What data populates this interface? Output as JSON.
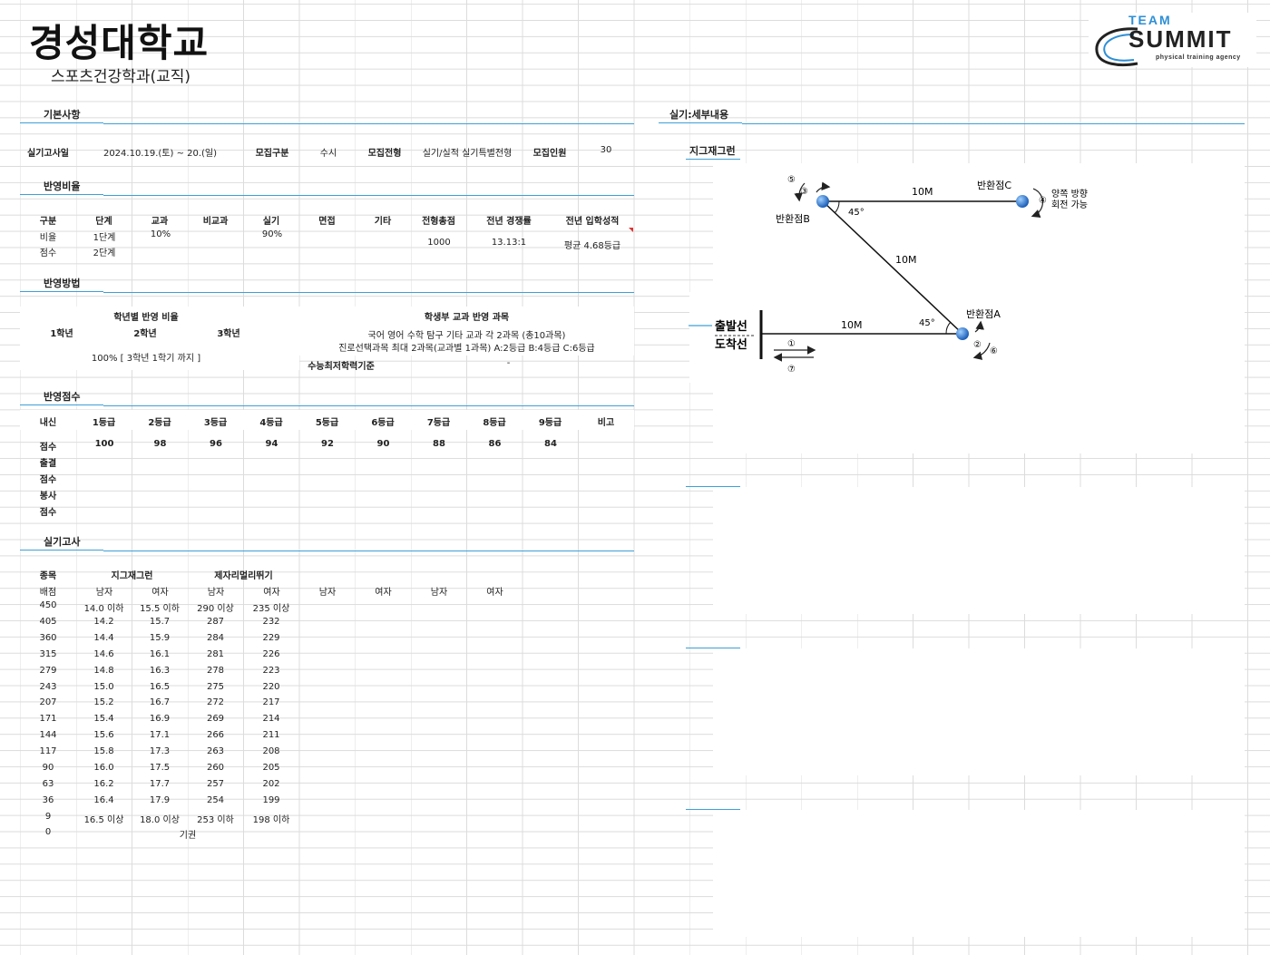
{
  "header": {
    "title": "경성대학교",
    "subtitle": "스포츠건강학과(교직)",
    "logo": {
      "team": "TEAM",
      "name": "SUMMIT",
      "tagline": "physical training agency"
    }
  },
  "sections": {
    "basic": "기본사항",
    "ratio": "반영비율",
    "method": "반영방법",
    "score": "반영점수",
    "practical": "실기고사",
    "detail": "실기:세부내용",
    "zigzag": "지그재그런"
  },
  "basic": {
    "date_label": "실기고사일",
    "date_value": "2024.10.19.(토) ~ 20.(일)",
    "type_label": "모집구분",
    "type_value": "수시",
    "track_label": "모집전형",
    "track_value": "실기/실적 실기특별전형",
    "quota_label": "모집인원",
    "quota_value": "30"
  },
  "ratio": {
    "headers": [
      "구분",
      "단계",
      "교과",
      "비교과",
      "실기",
      "면접",
      "기타",
      "전형총점",
      "전년 경쟁률",
      "전년 입학성적"
    ],
    "row1": [
      "비율",
      "1단계",
      "10%",
      "",
      "90%"
    ],
    "row2": [
      "점수",
      "2단계"
    ],
    "total": "1000",
    "competition": "13.13:1",
    "prev_grade": "평균 4.68등급"
  },
  "method": {
    "year_title": "학년별 반영 비율",
    "years": [
      "1학년",
      "2학년",
      "3학년"
    ],
    "year_value": "100% [ 3학년 1학기 까지 ]",
    "subject_title": "학생부 교과 반영 과목",
    "subject_line1": "국어 영어 수학 탐구 기타 교과 각 2과목 (총10과목)",
    "subject_line2": "진로선택과목 최대 2과목(교과별 1과목) A:2등급 B:4등급 C:6등급",
    "min_label": "수능최저학력기준",
    "min_value": "-"
  },
  "score": {
    "headers": [
      "내신",
      "1등급",
      "2등급",
      "3등급",
      "4등급",
      "5등급",
      "6등급",
      "7등급",
      "8등급",
      "9등급",
      "비고"
    ],
    "row_label": "점수",
    "values": [
      "100",
      "98",
      "96",
      "94",
      "92",
      "90",
      "88",
      "86",
      "84"
    ],
    "extra_rows": [
      "출결",
      "점수",
      "봉사",
      "점수"
    ]
  },
  "practical": {
    "event_label": "종목",
    "event1": "지그재그런",
    "event2": "제자리멀리뛰기",
    "score_label": "배점",
    "sub_headers": [
      "남자",
      "여자",
      "남자",
      "여자",
      "남자",
      "여자",
      "남자",
      "여자"
    ],
    "rows": [
      [
        "450",
        "14.0 이하",
        "15.5 이하",
        "290 이상",
        "235 이상"
      ],
      [
        "405",
        "14.2",
        "15.7",
        "287",
        "232"
      ],
      [
        "360",
        "14.4",
        "15.9",
        "284",
        "229"
      ],
      [
        "315",
        "14.6",
        "16.1",
        "281",
        "226"
      ],
      [
        "279",
        "14.8",
        "16.3",
        "278",
        "223"
      ],
      [
        "243",
        "15.0",
        "16.5",
        "275",
        "220"
      ],
      [
        "207",
        "15.2",
        "16.7",
        "272",
        "217"
      ],
      [
        "171",
        "15.4",
        "16.9",
        "269",
        "214"
      ],
      [
        "144",
        "15.6",
        "17.1",
        "266",
        "211"
      ],
      [
        "117",
        "15.8",
        "17.3",
        "263",
        "208"
      ],
      [
        "90",
        "16.0",
        "17.5",
        "260",
        "205"
      ],
      [
        "63",
        "16.2",
        "17.7",
        "257",
        "202"
      ],
      [
        "36",
        "16.4",
        "17.9",
        "254",
        "199"
      ],
      [
        "9",
        "16.5 이상",
        "18.0 이상",
        "253 이하",
        "198 이하"
      ]
    ],
    "last_row": [
      "0",
      "기권"
    ]
  },
  "diagram": {
    "start_line": "출발선",
    "finish_line": "도착선",
    "point_a": "반환점A",
    "point_b": "반환점B",
    "point_c": "반환점C",
    "dist_1": "10M",
    "dist_2": "10M",
    "dist_3": "10M",
    "angle_1": "45°",
    "angle_2": "45°",
    "note_line1": "양쪽 방향",
    "note_line2": "회전 가능",
    "step_1": "①",
    "step_2": "②",
    "step_3": "③",
    "step_4": "④",
    "step_5": "⑤",
    "step_6": "⑥",
    "step_7": "⑦"
  }
}
